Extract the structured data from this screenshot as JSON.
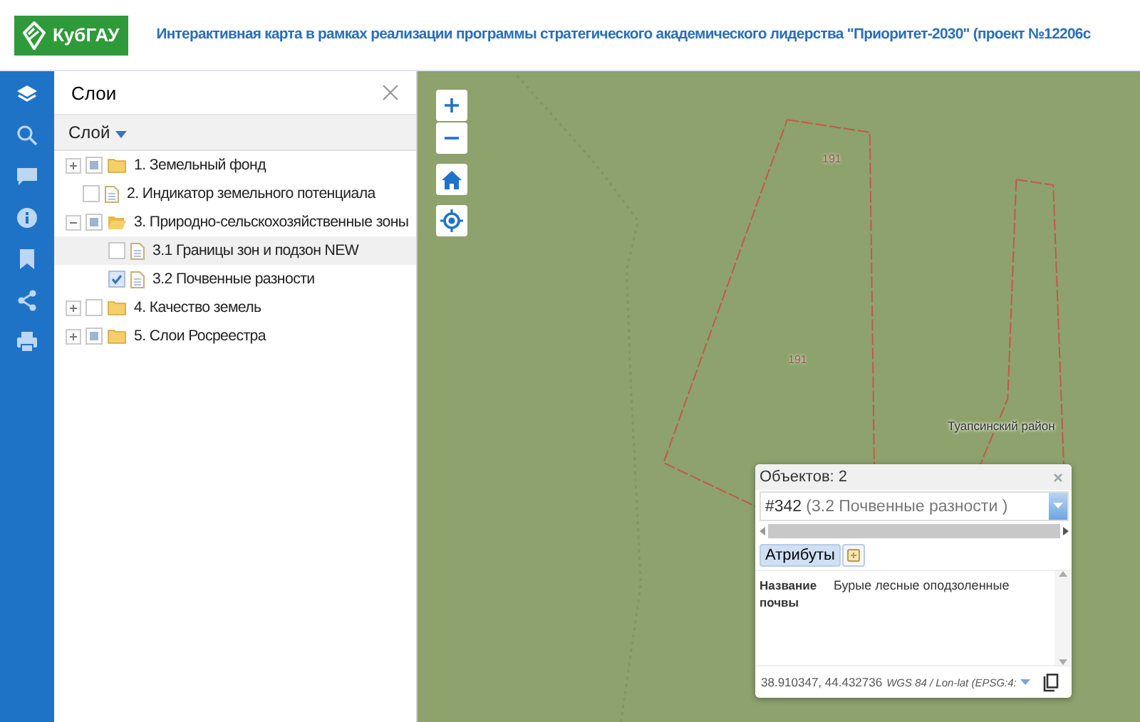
{
  "header": {
    "logo_text": "КубГАУ",
    "title": "Интерактивная карта в рамках реализации программы стратегического академического лидерства \"Приоритет-2030\" (проект №12206с"
  },
  "layers_panel": {
    "title": "Слои",
    "dropdown": "Слой",
    "tree": [
      {
        "kind": "folder",
        "label": "1. Земельный фонд",
        "checked": false,
        "partial": true,
        "expanded": false,
        "selected": false
      },
      {
        "kind": "layer",
        "label": "2. Индикатор земельного потенциала",
        "checked": false,
        "selected": false
      },
      {
        "kind": "folder",
        "label": "3. Природно-сельскохозяйственные зоны",
        "checked": false,
        "partial": true,
        "expanded": true,
        "selected": false,
        "children": [
          {
            "kind": "layer",
            "label": "3.1 Границы зон и подзон NEW",
            "checked": false,
            "selected": true
          },
          {
            "kind": "layer",
            "label": "3.2 Почвенные разности",
            "checked": true,
            "selected": false
          }
        ]
      },
      {
        "kind": "folder",
        "label": "4. Качество земель",
        "checked": false,
        "partial": false,
        "expanded": false,
        "selected": false
      },
      {
        "kind": "folder",
        "label": "5. Слои Росреестра",
        "checked": false,
        "partial": true,
        "expanded": false,
        "selected": false
      }
    ]
  },
  "map": {
    "labels": [
      {
        "text": "191",
        "kind": "parcel"
      },
      {
        "text": "191",
        "kind": "parcel"
      },
      {
        "text": "Туапсинский район",
        "kind": "district"
      }
    ]
  },
  "popup": {
    "title": "Объектов: 2",
    "select_id": "#342",
    "select_layer": "(3.2 Почвенные разности )",
    "tabs": [
      {
        "label": "Атрибуты",
        "selected": true
      }
    ],
    "attributes": [
      {
        "name": "Название почвы",
        "value": "Бурые лесные оподзоленные"
      }
    ],
    "coordinates": "38.910347, 44.432736",
    "projection": "WGS 84 / Lon-lat (EPSG:4:"
  }
}
